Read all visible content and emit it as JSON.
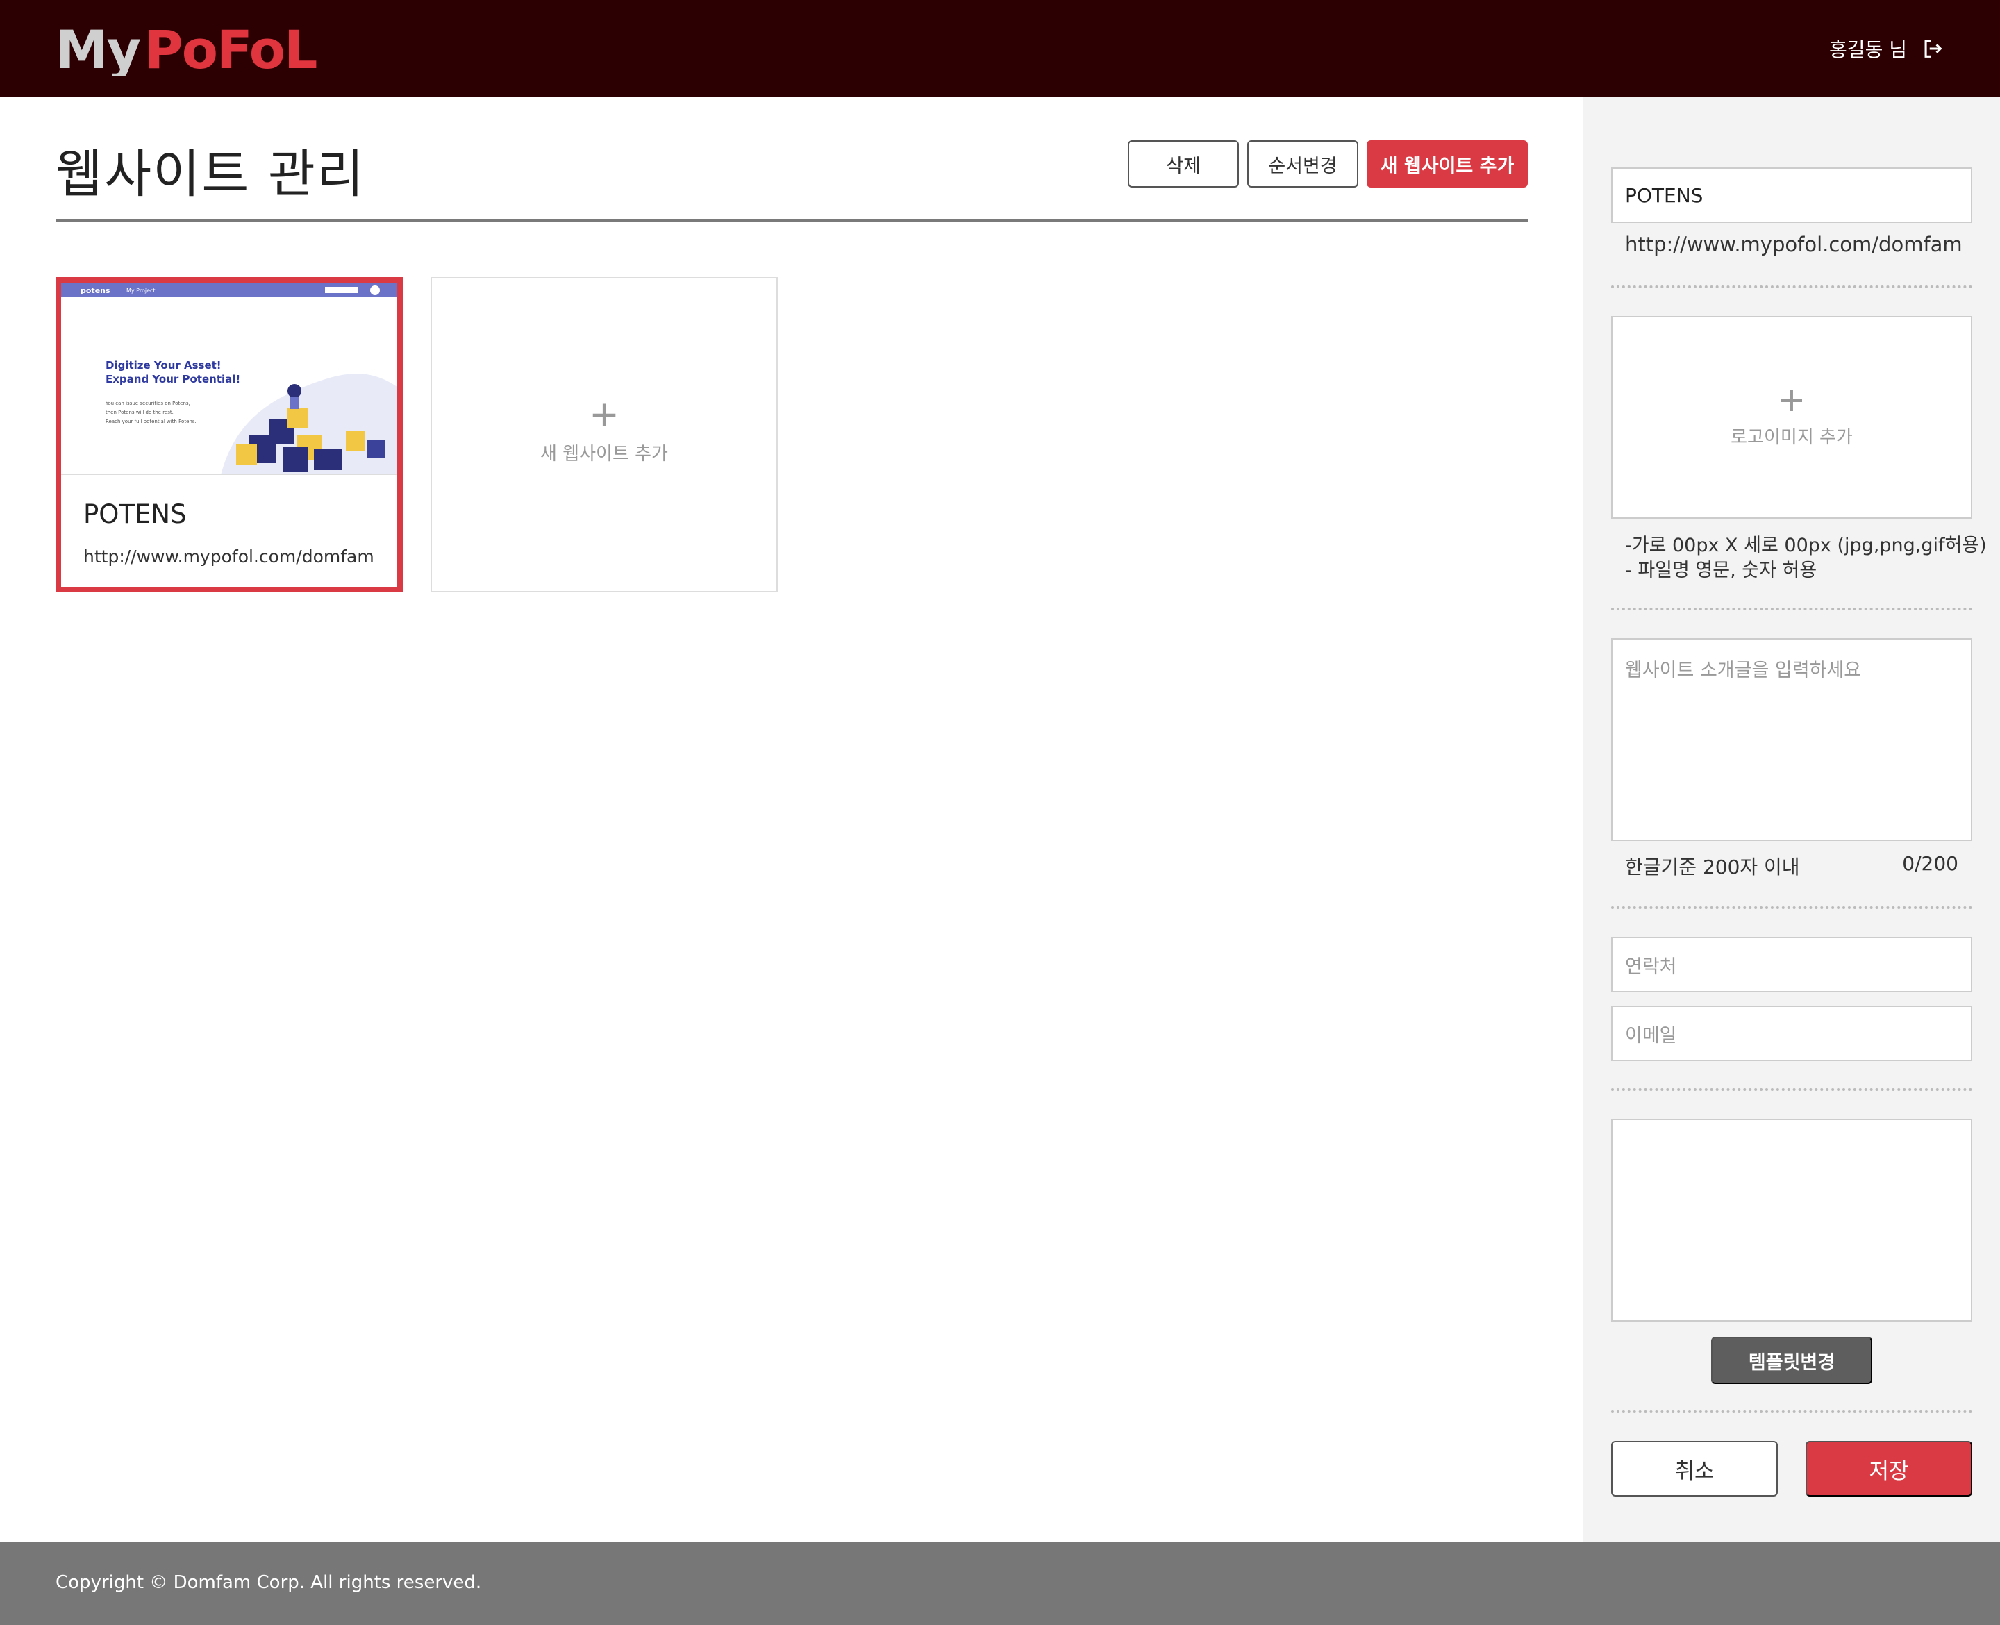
{
  "header": {
    "logo_text": "MyPoFoL",
    "user_label": "홍길동 님"
  },
  "page": {
    "title": "웹사이트 관리",
    "toolbar": {
      "delete_label": "삭제",
      "reorder_label": "순서변경",
      "new_label": "새 웹사이트 추가"
    }
  },
  "websites": [
    {
      "name": "POTENS",
      "url": "http://www.mypofol.com/domfam",
      "selected": true,
      "thumbnail": {
        "brand": "potens",
        "nav_item": "My Project",
        "headline_1": "Digitize Your Asset!",
        "headline_2": "Expand Your Potential!",
        "body_1": "You can issue securities on Potens,",
        "body_2": "then Potens will do the rest.",
        "body_3": "Reach your full potential with Potens."
      }
    }
  ],
  "add_card": {
    "plus": "+",
    "label": "새 웹사이트 추가"
  },
  "sidebar": {
    "name_value": "POTENS",
    "url_value": "http://www.mypofol.com/domfam",
    "logo_plus": "+",
    "logo_label": "로고이미지 추가",
    "hint_1": "-가로 00px X 세로 00px (jpg,png,gif허용)",
    "hint_2": "- 파일명 영문, 숫자 허용",
    "intro_placeholder": "웹사이트 소개글을 입력하세요",
    "count_label": "한글기준 200자 이내",
    "count_value": "0/200",
    "contact_placeholder": "연락처",
    "email_placeholder": "이메일",
    "template_label": "템플릿변경",
    "cancel_label": "취소",
    "save_label": "저장"
  },
  "footer": {
    "copyright": "Copyright © Domfam Corp. All rights reserved."
  },
  "colors": {
    "header_bg": "#2c0003",
    "accent": "#d93a43",
    "sidebar_bg": "#f3f3f3",
    "footer_bg": "#777777",
    "template_button": "#5e5e5e"
  }
}
